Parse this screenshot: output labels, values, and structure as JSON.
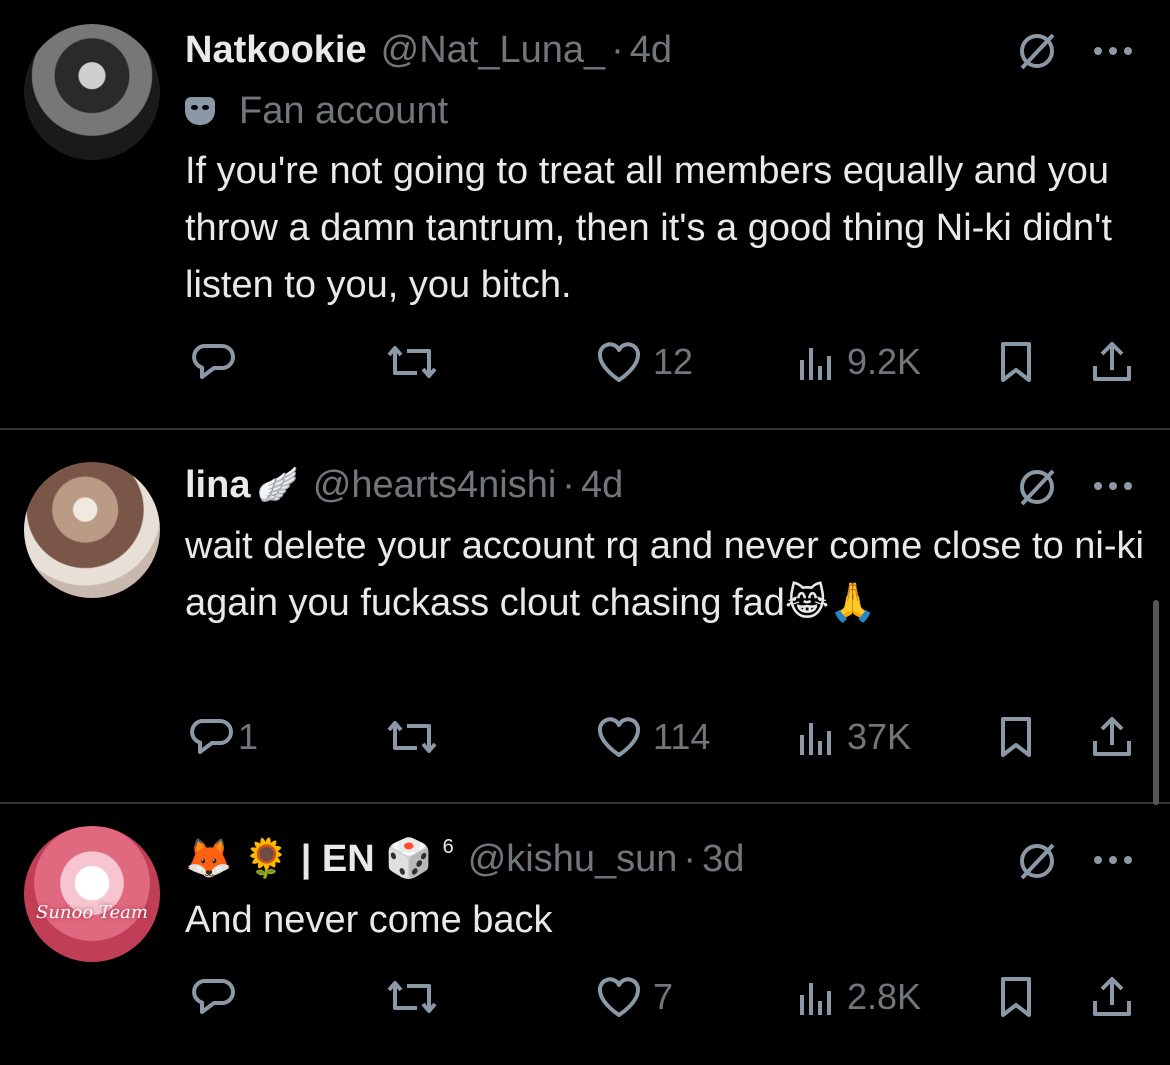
{
  "tweets": [
    {
      "name": "Natkookie",
      "handle": "@Nat_Luna_",
      "time": "4d",
      "badge": "Fan account",
      "text": "If you're not going to treat all members equally and you throw a damn tantrum, then it's a good thing Ni-ki didn't listen to you, you bitch.",
      "replies": "",
      "likes": "12",
      "views": "9.2K"
    },
    {
      "name": "lina",
      "name_emoji": "🪽",
      "handle": "@hearts4nishi",
      "time": "4d",
      "text": "wait delete your account rq and never come close to ni-ki again you fuckass clout chasing fad😹🙏",
      "replies": "1",
      "likes": "114",
      "views": "37K"
    },
    {
      "name": "🦊 🌻 | EN 🎲",
      "name_sup": "6",
      "handle": "@kishu_sun",
      "time": "3d",
      "avatar_text": "Sunoo Team",
      "text": "And never come back",
      "replies": "",
      "likes": "7",
      "views": "2.8K"
    }
  ],
  "icons": {
    "reply": "reply-icon",
    "retweet": "retweet-icon",
    "like": "like-icon",
    "views": "views-icon",
    "bookmark": "bookmark-icon",
    "share": "share-icon",
    "grok": "grok-icon",
    "more": "more-icon"
  },
  "colors": {
    "background": "#000000",
    "text": "#e7e9ea",
    "muted": "#71767b",
    "divider": "#2f3336"
  }
}
